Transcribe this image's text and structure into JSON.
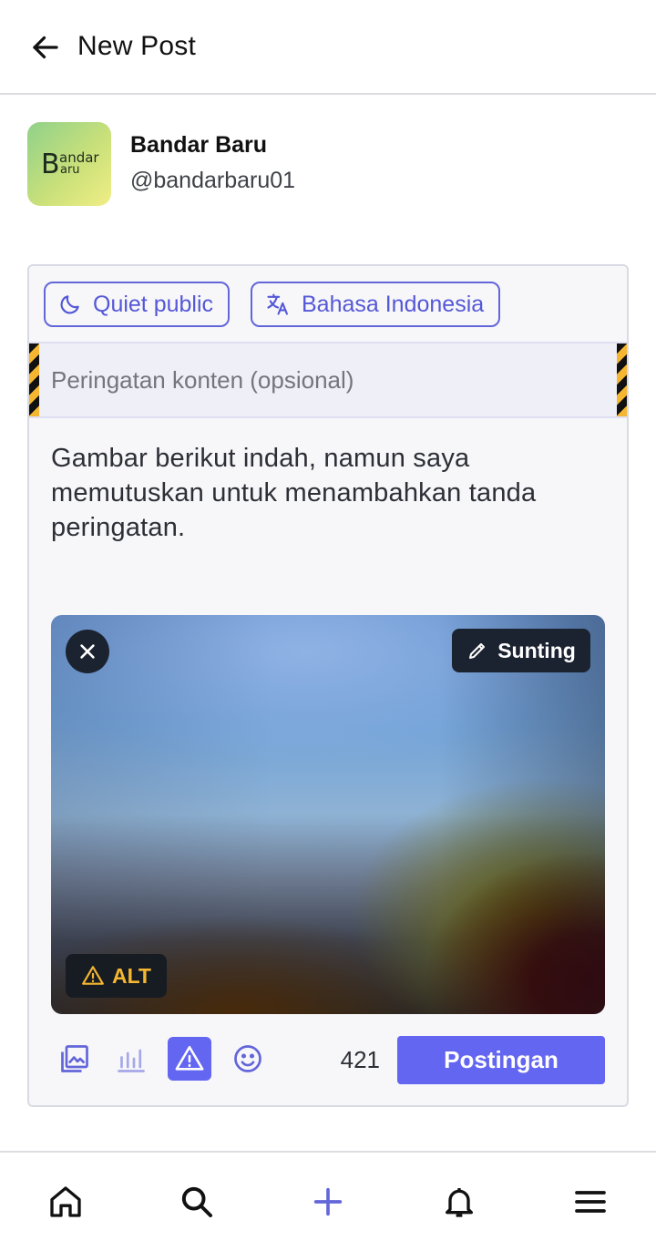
{
  "header": {
    "title": "New Post"
  },
  "account": {
    "display_name": "Bandar Baru",
    "username": "@bandarbaru01",
    "avatar_text": {
      "big": "B",
      "top": "andar",
      "bottom": "aru"
    }
  },
  "compose": {
    "visibility_label": "Quiet public",
    "language_label": "Bahasa Indonesia",
    "content_warning_placeholder": "Peringatan konten (opsional)",
    "content_warning_value": "",
    "text": "Gambar berikut indah, namun saya memutuskan untuk menambahkan tanda peringatan.",
    "media": {
      "edit_label": "Sunting",
      "alt_label": "ALT"
    },
    "char_count": "421",
    "submit_label": "Postingan"
  },
  "bottom_nav": [
    "home-icon",
    "search-icon",
    "plus-icon",
    "bell-icon",
    "menu-icon"
  ],
  "colors": {
    "accent": "#6366f1",
    "warning": "#f5b731",
    "dark_overlay": "#1c2330"
  }
}
